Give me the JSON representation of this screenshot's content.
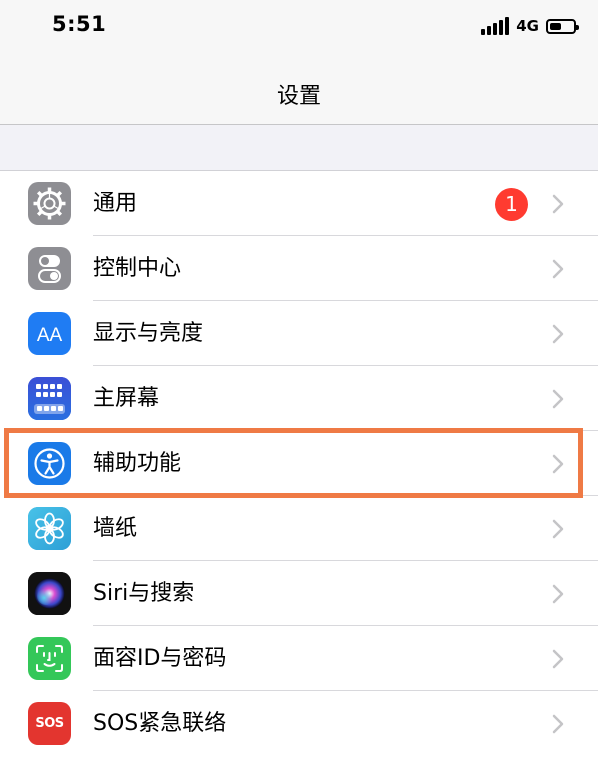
{
  "status_bar": {
    "time": "5:51",
    "network": "4G",
    "battery_level": 0.5
  },
  "nav": {
    "title": "设置"
  },
  "settings": [
    {
      "label": "通用",
      "icon": "gear-icon",
      "icon_bg": "#8e8e93",
      "badge": "1"
    },
    {
      "label": "控制中心",
      "icon": "toggle-switches-icon",
      "icon_bg": "#8e8e93"
    },
    {
      "label": "显示与亮度",
      "icon": "text-size-aa-icon",
      "icon_bg": "#1f7cf3"
    },
    {
      "label": "主屏幕",
      "icon": "home-screen-grid-icon",
      "icon_bg": "#2c50d4"
    },
    {
      "label": "辅助功能",
      "icon": "accessibility-person-icon",
      "icon_bg": "#1a7ae8",
      "highlighted": true
    },
    {
      "label": "墙纸",
      "icon": "flower-icon",
      "icon_bg": "#35aadc"
    },
    {
      "label": "Siri与搜索",
      "icon": "siri-orb-icon",
      "icon_bg": "#111111"
    },
    {
      "label": "面容ID与密码",
      "icon": "face-id-icon",
      "icon_bg": "#34c759"
    },
    {
      "label": "SOS紧急联络",
      "icon": "sos-icon",
      "icon_bg": "#e3352f",
      "icon_text": "SOS"
    }
  ],
  "colors": {
    "highlight_border": "#ef7a45",
    "badge": "#ff3b30",
    "chevron": "#c4c4c7"
  }
}
